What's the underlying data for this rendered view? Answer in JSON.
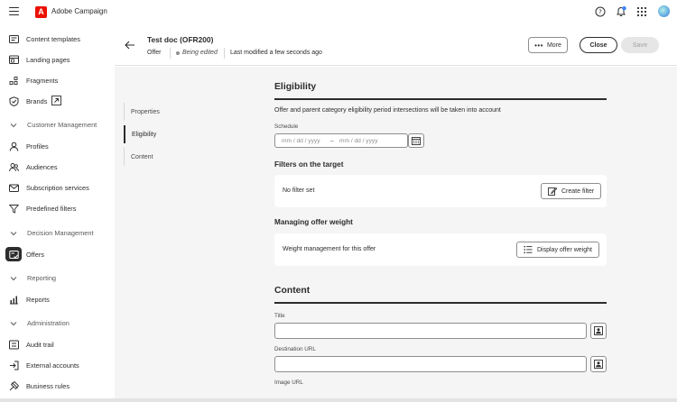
{
  "app": {
    "title": "Adobe Campaign",
    "logo_icon": "adobe-logo-icon"
  },
  "topbar": {
    "icons": [
      "help-icon",
      "notification-bell-icon",
      "apps-grid-icon",
      "user-avatar"
    ]
  },
  "sidebar": {
    "items_top": [
      {
        "label": "Content templates",
        "icon": "content-templates-icon"
      },
      {
        "label": "Landing pages",
        "icon": "landing-pages-icon"
      },
      {
        "label": "Fragments",
        "icon": "fragments-icon"
      },
      {
        "label": "Brands",
        "icon": "brands-icon"
      }
    ],
    "customer_management": {
      "label": "Customer Management",
      "items": [
        {
          "label": "Profiles",
          "icon": "profile-icon"
        },
        {
          "label": "Audiences",
          "icon": "audiences-icon"
        },
        {
          "label": "Subscription services",
          "icon": "subscription-icon"
        },
        {
          "label": "Predefined filters",
          "icon": "filter-icon"
        }
      ]
    },
    "decision_management": {
      "label": "Decision Management",
      "items": [
        {
          "label": "Offers",
          "icon": "offers-icon"
        }
      ]
    },
    "reporting": {
      "label": "Reporting",
      "items": [
        {
          "label": "Reports",
          "icon": "reports-icon"
        }
      ]
    },
    "administration": {
      "label": "Administration",
      "items": [
        {
          "label": "Audit trail",
          "icon": "audit-trail-icon"
        },
        {
          "label": "External accounts",
          "icon": "external-accounts-icon"
        },
        {
          "label": "Business rules",
          "icon": "business-rules-icon"
        }
      ]
    }
  },
  "header": {
    "title": "Test doc (OFR200)",
    "type": "Offer",
    "status": "Being edited",
    "modified": "Last modified a few seconds ago",
    "more_label": "More",
    "close_label": "Close",
    "save_label": "Save"
  },
  "section_nav": {
    "items": [
      "Properties",
      "Eligibility",
      "Content"
    ],
    "active": "Eligibility"
  },
  "eligibility": {
    "heading": "Eligibility",
    "description": "Offer and parent category eligibility period intersections will be taken into account",
    "schedule_label": "Schedule",
    "start_placeholder": "mm / dd / yyyy",
    "separator": "–",
    "end_placeholder": "mm / dd / yyyy",
    "filters_heading": "Filters on the target",
    "no_filter_text": "No filter set",
    "create_filter_label": "Create filter",
    "weight_heading": "Managing offer weight",
    "weight_text": "Weight management for this offer",
    "display_weight_label": "Display offer weight"
  },
  "content": {
    "heading": "Content",
    "title_label": "Title",
    "title_value": "",
    "destination_label": "Destination URL",
    "destination_value": "",
    "image_label": "Image URL"
  },
  "colors": {
    "adobe_red": "#eb1000",
    "text_primary": "#2c2c2c",
    "notification_badge": "#3b82f6",
    "main_background": "#f5f5f5"
  }
}
